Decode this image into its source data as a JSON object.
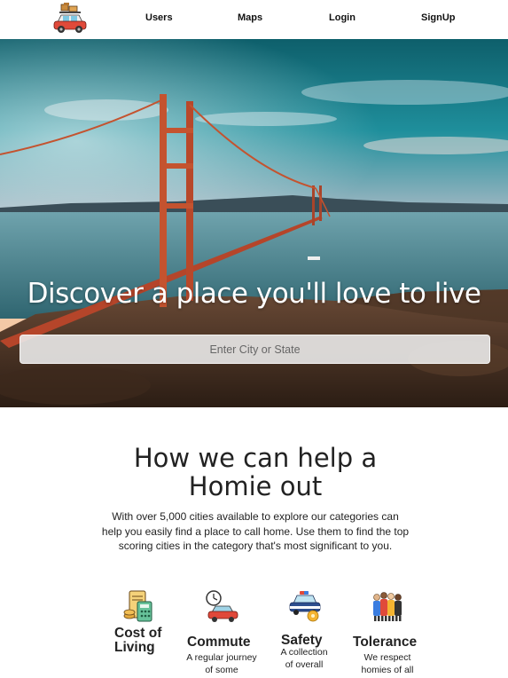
{
  "nav": {
    "links": [
      {
        "label": "Users"
      },
      {
        "label": "Maps"
      },
      {
        "label": "Login"
      },
      {
        "label": "SignUp"
      }
    ]
  },
  "hero": {
    "title": "Discover a place you'll love to live",
    "search_placeholder": "Enter City or State"
  },
  "how": {
    "title": "How we can help a Homie out",
    "description": "With over 5,000 cities available to explore our categories can help you easily find a place to call home. Use them to find the top scoring cities in the category that's most significant to you."
  },
  "categories": [
    {
      "title": "Cost of Living",
      "description": "",
      "icon": "calculator-icon"
    },
    {
      "title": "Commute",
      "description": "A regular journey of some",
      "icon": "car-clock-icon"
    },
    {
      "title": "Safety",
      "description": "A collection of overall",
      "icon": "police-car-icon"
    },
    {
      "title": "Tolerance",
      "description": "We respect homies of all",
      "icon": "people-icon"
    }
  ]
}
